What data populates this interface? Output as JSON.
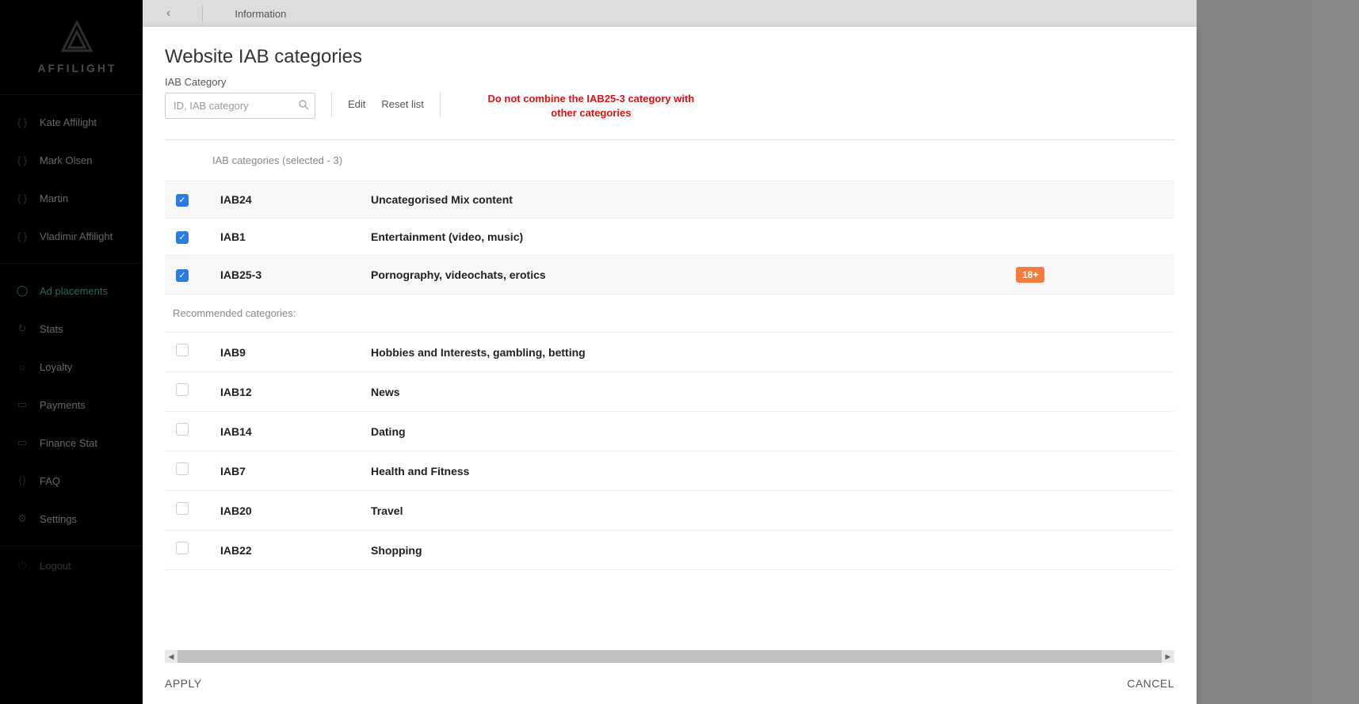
{
  "logo": {
    "text": "AFFILIGHT"
  },
  "sidebar": {
    "users": [
      {
        "label": "Kate Affilight"
      },
      {
        "label": "Mark Olsen"
      },
      {
        "label": "Martin"
      },
      {
        "label": "Vladimir Affilight"
      }
    ],
    "items": [
      {
        "label": "Ad placements"
      },
      {
        "label": "Stats"
      },
      {
        "label": "Loyalty"
      },
      {
        "label": "Payments"
      },
      {
        "label": "Finance Stat"
      },
      {
        "label": "FAQ"
      },
      {
        "label": "Settings"
      },
      {
        "label": "Logout"
      }
    ]
  },
  "topbar": {
    "tab": "Information"
  },
  "modal": {
    "title": "Website IAB categories",
    "search_label": "IAB Category",
    "search_placeholder": "ID, IAB category",
    "edit_label": "Edit",
    "reset_label": "Reset list",
    "warning": "Do not combine the IAB25-3 category with other categories",
    "table_header": "IAB categories (selected - 3)",
    "selected": [
      {
        "code": "IAB24",
        "desc": "Uncategorised Mix content",
        "badge": ""
      },
      {
        "code": "IAB1",
        "desc": "Entertainment (video, music)",
        "badge": ""
      },
      {
        "code": "IAB25-3",
        "desc": "Pornography, videochats, erotics",
        "badge": "18+"
      }
    ],
    "recommended_label": "Recommended categories:",
    "recommended": [
      {
        "code": "IAB9",
        "desc": "Hobbies and Interests, gambling, betting"
      },
      {
        "code": "IAB12",
        "desc": "News"
      },
      {
        "code": "IAB14",
        "desc": "Dating"
      },
      {
        "code": "IAB7",
        "desc": "Health and Fitness"
      },
      {
        "code": "IAB20",
        "desc": "Travel"
      },
      {
        "code": "IAB22",
        "desc": "Shopping"
      }
    ],
    "apply_label": "APPLY",
    "cancel_label": "CANCEL"
  }
}
